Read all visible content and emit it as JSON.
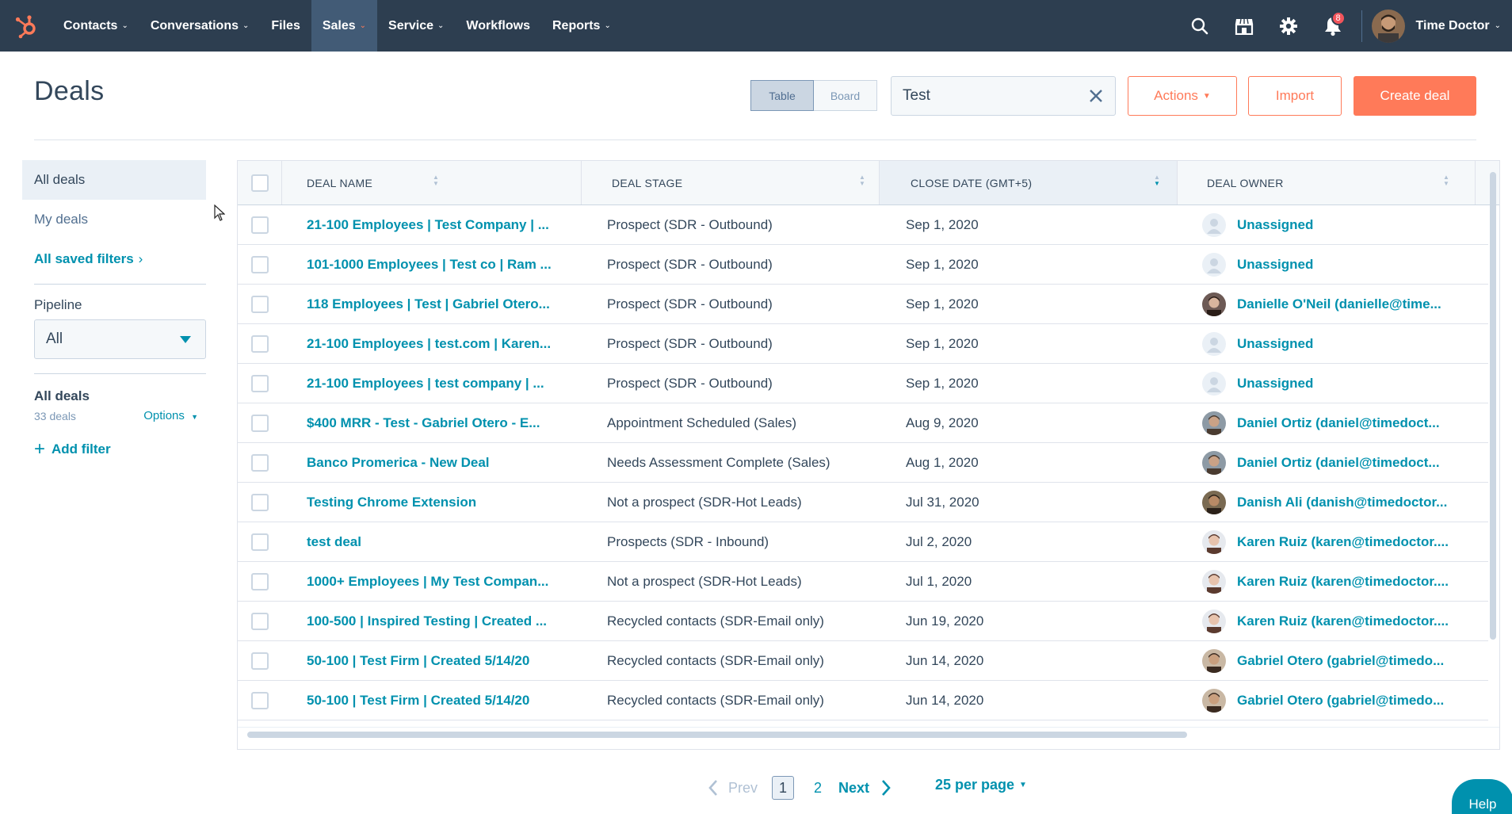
{
  "nav": {
    "items": [
      {
        "label": "Contacts",
        "has_menu": true
      },
      {
        "label": "Conversations",
        "has_menu": true
      },
      {
        "label": "Files",
        "has_menu": false
      },
      {
        "label": "Sales",
        "has_menu": true,
        "active": true
      },
      {
        "label": "Service",
        "has_menu": true
      },
      {
        "label": "Workflows",
        "has_menu": false
      },
      {
        "label": "Reports",
        "has_menu": true
      }
    ],
    "notification_count": "8",
    "account_name": "Time Doctor",
    "icons": [
      "search-icon",
      "marketplace-icon",
      "settings-gear-icon",
      "notifications-bell-icon"
    ]
  },
  "header": {
    "title": "Deals",
    "view_table": "Table",
    "view_board": "Board",
    "search_value": "Test",
    "actions_label": "Actions",
    "import_label": "Import",
    "create_label": "Create deal"
  },
  "sidebar": {
    "all_deals": "All deals",
    "my_deals": "My deals",
    "saved_filters": "All saved filters",
    "pipeline_label": "Pipeline",
    "pipeline_value": "All",
    "view_name": "All deals",
    "deal_count": "33 deals",
    "options_label": "Options",
    "add_filter": "Add filter"
  },
  "table": {
    "columns": [
      "DEAL NAME",
      "DEAL STAGE",
      "CLOSE DATE (GMT+5)",
      "DEAL OWNER"
    ],
    "sorted_column": "CLOSE DATE (GMT+5)",
    "rows": [
      {
        "name": "21-100 Employees | Test Company | ...",
        "stage": "Prospect (SDR - Outbound)",
        "close": "Sep 1, 2020",
        "owner": "Unassigned",
        "avatar": "unassigned"
      },
      {
        "name": "101-1000 Employees | Test co | Ram ...",
        "stage": "Prospect (SDR - Outbound)",
        "close": "Sep 1, 2020",
        "owner": "Unassigned",
        "avatar": "unassigned"
      },
      {
        "name": "118 Employees | Test | Gabriel Otero...",
        "stage": "Prospect (SDR - Outbound)",
        "close": "Sep 1, 2020",
        "owner": "Danielle O'Neil (danielle@time...",
        "avatar": "woman-dark"
      },
      {
        "name": "21-100 Employees | test.com | Karen...",
        "stage": "Prospect (SDR - Outbound)",
        "close": "Sep 1, 2020",
        "owner": "Unassigned",
        "avatar": "unassigned"
      },
      {
        "name": "21-100 Employees | test company | ...",
        "stage": "Prospect (SDR - Outbound)",
        "close": "Sep 1, 2020",
        "owner": "Unassigned",
        "avatar": "unassigned"
      },
      {
        "name": "$400 MRR - Test - Gabriel Otero - E...",
        "stage": "Appointment Scheduled (Sales)",
        "close": "Aug 9, 2020",
        "owner": "Daniel Ortiz (daniel@timedoct...",
        "avatar": "man-grey"
      },
      {
        "name": "Banco Promerica - New Deal",
        "stage": "Needs Assessment Complete (Sales)",
        "close": "Aug 1, 2020",
        "owner": "Daniel Ortiz (daniel@timedoct...",
        "avatar": "man-grey"
      },
      {
        "name": "Testing Chrome Extension",
        "stage": "Not a prospect (SDR-Hot Leads)",
        "close": "Jul 31, 2020",
        "owner": "Danish Ali (danish@timedoctor...",
        "avatar": "man-beard"
      },
      {
        "name": "test deal",
        "stage": "Prospects (SDR - Inbound)",
        "close": "Jul 2, 2020",
        "owner": "Karen Ruiz (karen@timedoctor....",
        "avatar": "woman-light"
      },
      {
        "name": "1000+ Employees | My Test Compan...",
        "stage": "Not a prospect (SDR-Hot Leads)",
        "close": "Jul 1, 2020",
        "owner": "Karen Ruiz (karen@timedoctor....",
        "avatar": "woman-light"
      },
      {
        "name": "100-500 | Inspired Testing | Created ...",
        "stage": "Recycled contacts (SDR-Email only)",
        "close": "Jun 19, 2020",
        "owner": "Karen Ruiz (karen@timedoctor....",
        "avatar": "woman-light"
      },
      {
        "name": "50-100 | Test Firm | Created 5/14/20",
        "stage": "Recycled contacts (SDR-Email only)",
        "close": "Jun 14, 2020",
        "owner": "Gabriel Otero (gabriel@timedo...",
        "avatar": "man-tan"
      },
      {
        "name": "50-100 | Test Firm | Created 5/14/20",
        "stage": "Recycled contacts (SDR-Email only)",
        "close": "Jun 14, 2020",
        "owner": "Gabriel Otero (gabriel@timedo...",
        "avatar": "man-tan"
      }
    ]
  },
  "pagination": {
    "prev": "Prev",
    "pages": [
      "1",
      "2"
    ],
    "current": "1",
    "next": "Next",
    "per_page": "25 per page"
  },
  "help_label": "Help",
  "colors": {
    "nav_bg": "#2d3e50",
    "accent_orange": "#ff7a59",
    "link_teal": "#0091ae",
    "text_dark": "#33475b"
  }
}
